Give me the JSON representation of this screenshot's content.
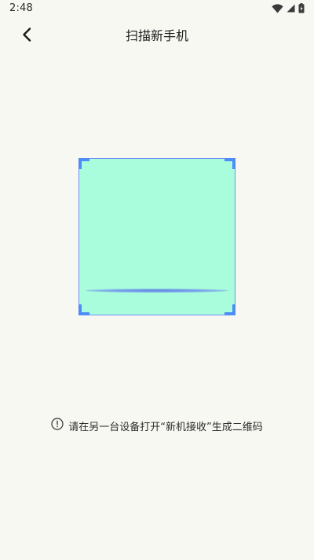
{
  "status_bar": {
    "time": "2:48",
    "icons": [
      "wifi-icon",
      "cellular-signal-icon",
      "battery-icon"
    ]
  },
  "header": {
    "title": "扫描新手机",
    "back_icon": "chevron-left-icon"
  },
  "scanner": {
    "frame_color": "#4f8cf5",
    "fill_color": "#a9fcdc",
    "scan_line_color": "#5d8be0"
  },
  "hint": {
    "icon": "info-circle-icon",
    "text": "请在另一台设备打开“新机接收”生成二维码"
  },
  "colors": {
    "background": "#f8f8f3"
  }
}
